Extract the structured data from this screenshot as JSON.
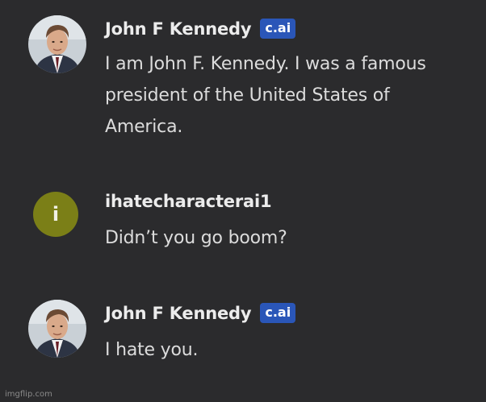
{
  "messages": [
    {
      "author": "John F Kennedy",
      "badge": "c.ai",
      "text": "I am John F. Kennedy. I was a famous president of the United States of America.",
      "avatar": "jfk-portrait"
    },
    {
      "author": "ihatecharacterai1",
      "avatar_letter": "i",
      "text": "Didn’t you go boom?",
      "avatar_color": "#7b7f17"
    },
    {
      "author": "John F Kennedy",
      "badge": "c.ai",
      "text": "I hate you.",
      "avatar": "jfk-portrait"
    }
  ],
  "watermark": "imgflip.com",
  "colors": {
    "background": "#2b2b2d",
    "badge": "#2a56b8",
    "user_avatar": "#7b7f17"
  }
}
